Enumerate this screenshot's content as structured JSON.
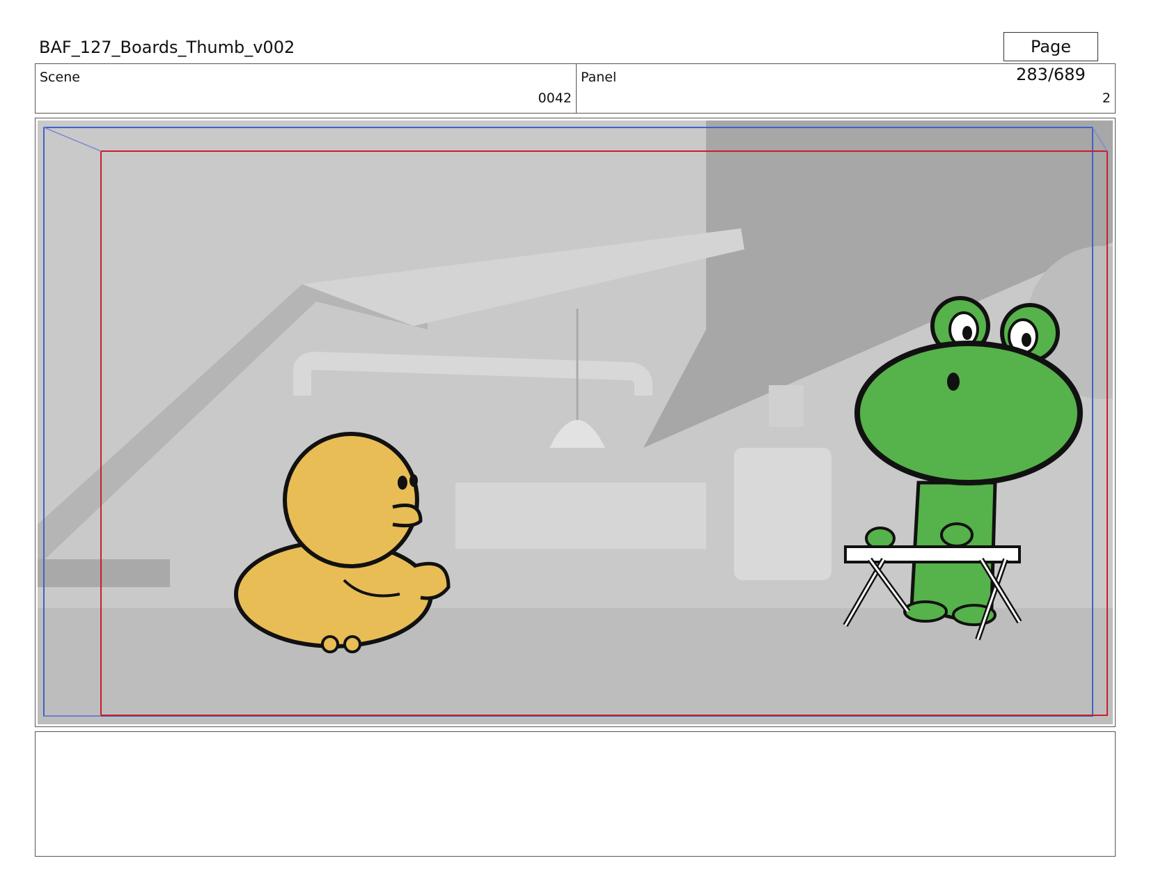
{
  "document": {
    "title": "BAF_127_Boards_Thumb_v002",
    "page": "Page 283/689"
  },
  "info": {
    "scene_label": "Scene",
    "scene_value": "0042",
    "panel_label": "Panel",
    "panel_value": "2"
  },
  "panel_image": {
    "safe_area_outer_color": "#3d63c8",
    "safe_area_inner_color": "#c81e2c",
    "duck_color": "#e8bd55",
    "frog_color": "#56b24a"
  },
  "notes": {
    "text": ""
  }
}
